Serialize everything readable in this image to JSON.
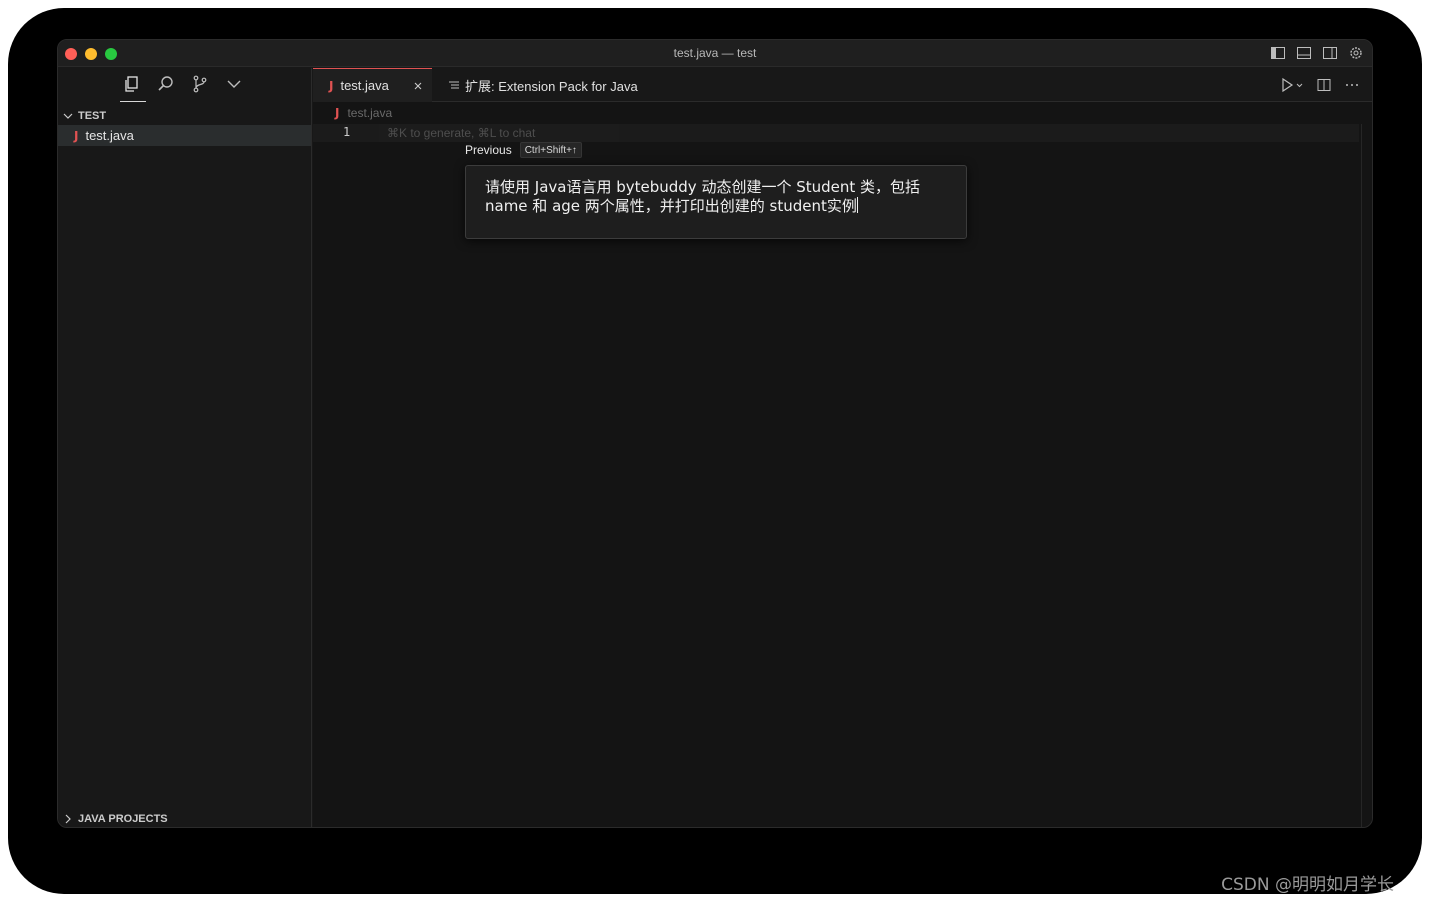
{
  "window": {
    "title": "test.java — test"
  },
  "sidebar": {
    "icons": [
      "explorer-icon",
      "search-icon",
      "source-control-icon",
      "chevron-down-icon"
    ],
    "section_title": "TEST",
    "files": [
      {
        "name": "test.java",
        "icon": "java-file-icon"
      }
    ],
    "bottom_section_title": "JAVA PROJECTS"
  },
  "tabs": {
    "active": {
      "label": "test.java"
    },
    "other": {
      "label": "扩展: Extension Pack for Java"
    }
  },
  "editor": {
    "breadcrumb": "test.java",
    "line_number": "1",
    "hint": "⌘K to generate, ⌘L to chat",
    "previous_label": "Previous",
    "previous_shortcut": "Ctrl+Shift+↑",
    "prompt_text": "请使用 Java语言用 bytebuddy 动态创建一个 Student 类，包括\nname 和 age 两个属性，并打印出创建的 student实例"
  },
  "watermark": "CSDN @明明如月学长",
  "colors": {
    "java_icon": "#e05252",
    "accent": "#e05252"
  }
}
